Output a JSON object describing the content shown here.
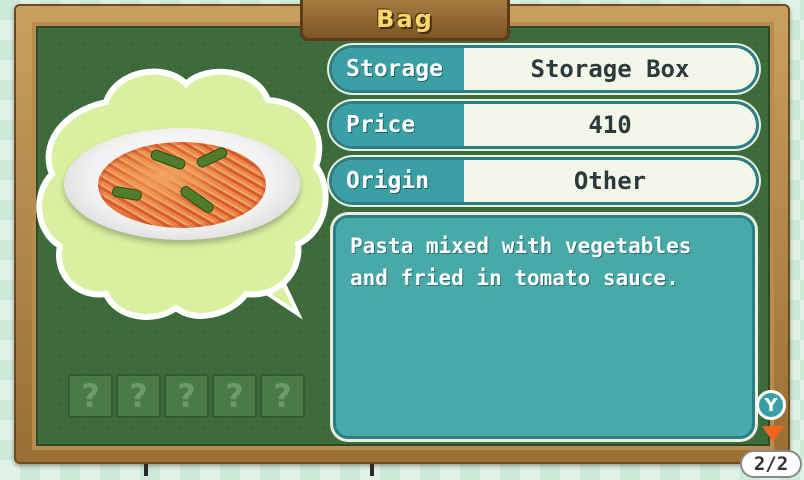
{
  "window": {
    "title": "Bag"
  },
  "item": {
    "image_icon": "spaghetti-dish-icon",
    "fields": [
      {
        "label": "Storage",
        "value": "Storage Box"
      },
      {
        "label": "Price",
        "value": "410"
      },
      {
        "label": "Origin",
        "value": "Other"
      }
    ],
    "description": "Pasta mixed with vegetables and fried in tomato sauce."
  },
  "unknown_slots": [
    "?",
    "?",
    "?",
    "?",
    "?"
  ],
  "controls": {
    "y_button_label": "Y",
    "y_button_icon": "y-button-icon",
    "scroll_icon": "scroll-down-arrow-icon",
    "page_indicator": "2/2"
  },
  "colors": {
    "board": "#3c6a3a",
    "label_bg": "#3aa0a5",
    "description_bg": "#48aaa8",
    "title_text": "#f7d96c",
    "arrow": "#f0641e"
  }
}
